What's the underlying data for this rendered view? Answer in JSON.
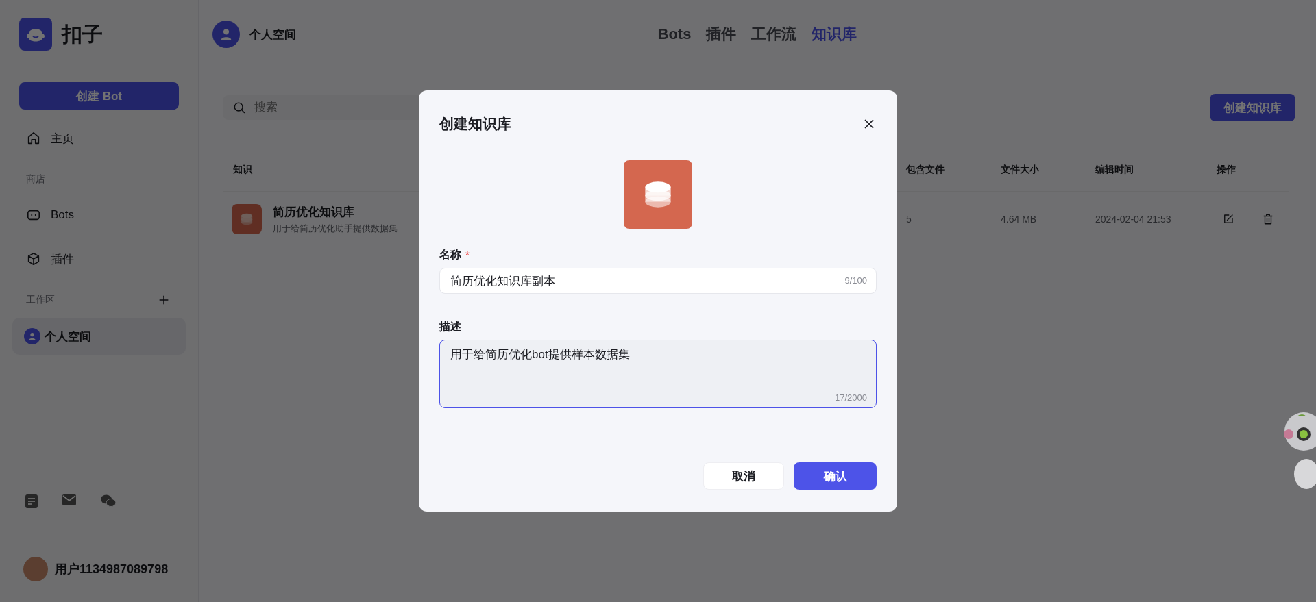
{
  "sidebar": {
    "logo": "扣子",
    "create_button": "创建 Bot",
    "items": [
      {
        "kind": "link",
        "label": "主页",
        "selected": false
      },
      {
        "kind": "section",
        "label": "商店"
      },
      {
        "kind": "link",
        "label": "Bots",
        "selected": false
      },
      {
        "kind": "link",
        "label": "插件",
        "selected": false
      },
      {
        "kind": "section",
        "label": "工作区",
        "addable": true
      },
      {
        "kind": "workspace",
        "label": "个人空间",
        "selected": true
      }
    ],
    "user": "用户1134987089798"
  },
  "header": {
    "workspace": "个人空间",
    "tabs": [
      {
        "label": "Bots",
        "selected": false
      },
      {
        "label": "插件",
        "selected": false
      },
      {
        "label": "工作流",
        "selected": false
      },
      {
        "label": "知识库",
        "selected": true
      }
    ]
  },
  "toolbar": {
    "search": {
      "placeholder": "搜索"
    },
    "create_button": "创建知识库"
  },
  "table": {
    "columns": [
      "知识",
      "包含文件",
      "文件大小",
      "编辑时间",
      "操作"
    ],
    "rows": [
      {
        "name": "简历优化知识库",
        "description": "用于给简历优化助手提供数据集",
        "files": "5",
        "size": "4.64 MB",
        "edited": "2024-02-04 21:53"
      }
    ]
  },
  "dialog": {
    "title": "创建知识库",
    "fields": [
      {
        "kind": "input",
        "label": "名称",
        "required_mark": "*",
        "value": "简历优化知识库副本",
        "count": "9/100",
        "focused": false
      },
      {
        "kind": "textarea",
        "label": "描述",
        "value": "用于给简历优化bot提供样本数据集",
        "count": "17/2000",
        "focused": true
      }
    ],
    "buttons": [
      {
        "kind": "secondary",
        "label": "取消"
      },
      {
        "kind": "primary",
        "label": "确认"
      }
    ]
  }
}
